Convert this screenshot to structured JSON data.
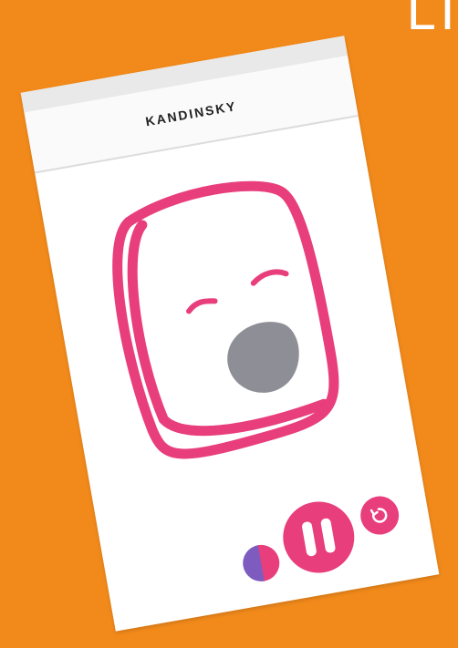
{
  "background_color": "#f28a1b",
  "corner_text": "LI",
  "app": {
    "title": "KANDINSKY",
    "accent_color": "#e83e7c",
    "mouth_color": "#8e8e96"
  },
  "controls": {
    "color_swatch": {
      "colors": [
        "#7e5bbe",
        "#e83e7c"
      ]
    },
    "pause_icon": "pause-icon",
    "reset_icon": "refresh-icon"
  }
}
